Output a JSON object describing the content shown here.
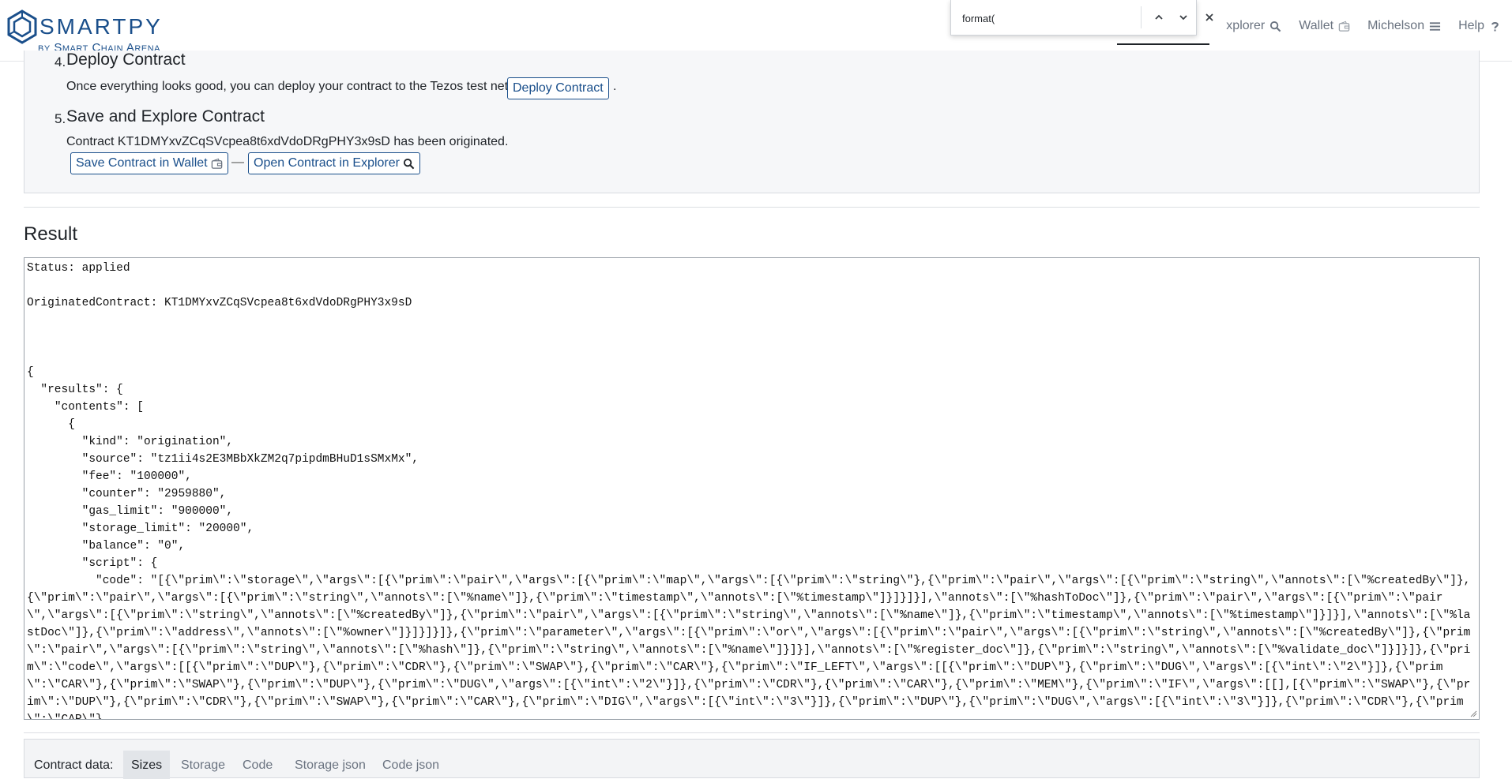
{
  "header": {
    "logo_text": "SMARTPY",
    "logo_sub": "by Smart Chain Arena",
    "nav": [
      {
        "label": "xplorer",
        "icon": "search-icon"
      },
      {
        "label": "Wallet",
        "icon": "wallet-icon"
      },
      {
        "label": "Michelson",
        "icon": "menu-icon"
      },
      {
        "label": "Help",
        "icon": "question-icon"
      }
    ]
  },
  "findbar": {
    "value": "format("
  },
  "steps": {
    "step4": {
      "number": "4.",
      "title": "Deploy Contract",
      "text": "Once everything looks good, you can deploy your contract to the Tezos test net:",
      "button": "Deploy Contract",
      "trailing": "."
    },
    "step5": {
      "number": "5.",
      "title": "Save and Explore Contract",
      "text": "Contract KT1DMYxvZCqSVcpea8t6xdVdoDRgPHY3x9sD has been originated.",
      "save_button": "Save Contract in Wallet",
      "dash": "—",
      "open_button": "Open Contract in Explorer"
    }
  },
  "result": {
    "title": "Result",
    "content": "Status: applied\n\nOriginatedContract: KT1DMYxvZCqSVcpea8t6xdVdoDRgPHY3x9sD\n\n\n\n{\n  \"results\": {\n    \"contents\": [\n      {\n        \"kind\": \"origination\",\n        \"source\": \"tz1ii4s2E3MBbXkZM2q7pipdmBHuD1sSMxMx\",\n        \"fee\": \"100000\",\n        \"counter\": \"2959880\",\n        \"gas_limit\": \"900000\",\n        \"storage_limit\": \"20000\",\n        \"balance\": \"0\",\n        \"script\": {\n          \"code\": \"[{\\\"prim\\\":\\\"storage\\\",\\\"args\\\":[{\\\"prim\\\":\\\"pair\\\",\\\"args\\\":[{\\\"prim\\\":\\\"map\\\",\\\"args\\\":[{\\\"prim\\\":\\\"string\\\"},{\\\"prim\\\":\\\"pair\\\",\\\"args\\\":[{\\\"prim\\\":\\\"string\\\",\\\"annots\\\":[\\\"%createdBy\\\"]},{\\\"prim\\\":\\\"pair\\\",\\\"args\\\":[{\\\"prim\\\":\\\"string\\\",\\\"annots\\\":[\\\"%name\\\"]},{\\\"prim\\\":\\\"timestamp\\\",\\\"annots\\\":[\\\"%timestamp\\\"]}]}]}],\\\"annots\\\":[\\\"%hashToDoc\\\"]},{\\\"prim\\\":\\\"pair\\\",\\\"args\\\":[{\\\"prim\\\":\\\"pair\\\",\\\"args\\\":[{\\\"prim\\\":\\\"string\\\",\\\"annots\\\":[\\\"%createdBy\\\"]},{\\\"prim\\\":\\\"pair\\\",\\\"args\\\":[{\\\"prim\\\":\\\"string\\\",\\\"annots\\\":[\\\"%name\\\"]},{\\\"prim\\\":\\\"timestamp\\\",\\\"annots\\\":[\\\"%timestamp\\\"]}]}],\\\"annots\\\":[\\\"%lastDoc\\\"]},{\\\"prim\\\":\\\"address\\\",\\\"annots\\\":[\\\"%owner\\\"]}]}]}]},{\\\"prim\\\":\\\"parameter\\\",\\\"args\\\":[{\\\"prim\\\":\\\"or\\\",\\\"args\\\":[{\\\"prim\\\":\\\"pair\\\",\\\"args\\\":[{\\\"prim\\\":\\\"string\\\",\\\"annots\\\":[\\\"%createdBy\\\"]},{\\\"prim\\\":\\\"pair\\\",\\\"args\\\":[{\\\"prim\\\":\\\"string\\\",\\\"annots\\\":[\\\"%hash\\\"]},{\\\"prim\\\":\\\"string\\\",\\\"annots\\\":[\\\"%name\\\"]}]}],\\\"annots\\\":[\\\"%register_doc\\\"]},{\\\"prim\\\":\\\"string\\\",\\\"annots\\\":[\\\"%validate_doc\\\"]}]}]},{\\\"prim\\\":\\\"code\\\",\\\"args\\\":[[{\\\"prim\\\":\\\"DUP\\\"},{\\\"prim\\\":\\\"CDR\\\"},{\\\"prim\\\":\\\"SWAP\\\"},{\\\"prim\\\":\\\"CAR\\\"},{\\\"prim\\\":\\\"IF_LEFT\\\",\\\"args\\\":[[{\\\"prim\\\":\\\"DUP\\\"},{\\\"prim\\\":\\\"DUG\\\",\\\"args\\\":[{\\\"int\\\":\\\"2\\\"}]},{\\\"prim\\\":\\\"CAR\\\"},{\\\"prim\\\":\\\"SWAP\\\"},{\\\"prim\\\":\\\"DUP\\\"},{\\\"prim\\\":\\\"DUG\\\",\\\"args\\\":[{\\\"int\\\":\\\"2\\\"}]},{\\\"prim\\\":\\\"CDR\\\"},{\\\"prim\\\":\\\"CAR\\\"},{\\\"prim\\\":\\\"MEM\\\"},{\\\"prim\\\":\\\"IF\\\",\\\"args\\\":[[],[{\\\"prim\\\":\\\"SWAP\\\"},{\\\"prim\\\":\\\"DUP\\\"},{\\\"prim\\\":\\\"CDR\\\"},{\\\"prim\\\":\\\"SWAP\\\"},{\\\"prim\\\":\\\"CAR\\\"},{\\\"prim\\\":\\\"DIG\\\",\\\"args\\\":[{\\\"int\\\":\\\"3\\\"}]},{\\\"prim\\\":\\\"DUP\\\"},{\\\"prim\\\":\\\"DUG\\\",\\\"args\\\":[{\\\"int\\\":\\\"3\\\"}]},{\\\"prim\\\":\\\"CDR\\\"},{\\\"prim\\\":\\\"CAR\\\"}"
  },
  "contract_data": {
    "label": "Contract data:",
    "tabs": [
      "Sizes",
      "Storage",
      "Code",
      "Storage json",
      "Code json"
    ],
    "active": "Sizes"
  },
  "colors": {
    "brand": "#1a4f8b",
    "panel_bg": "#f6f7f9"
  }
}
